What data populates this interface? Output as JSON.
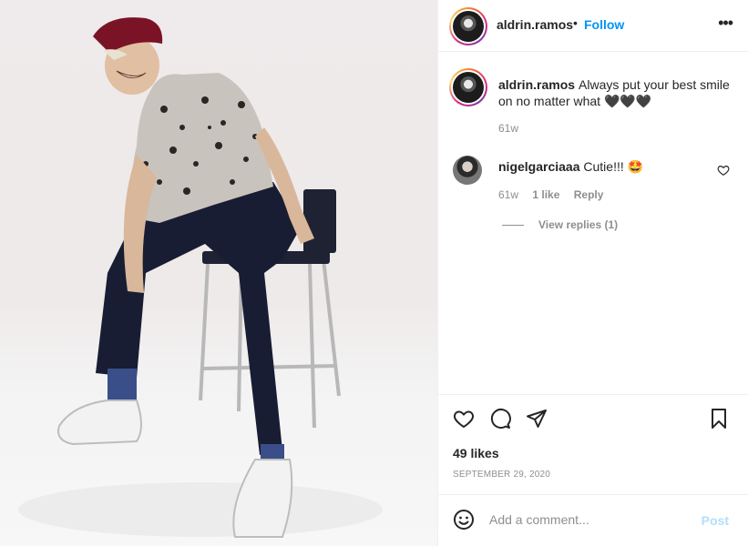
{
  "post": {
    "username": "aldrin.ramos",
    "separator": "•",
    "follow_label": "Follow",
    "more_glyph": "•••",
    "caption_user": "aldrin.ramos",
    "caption_text": "Always put your best smile on no matter what 🖤🖤🖤",
    "caption_time": "61w"
  },
  "comment": {
    "username": "nigelgarciaaa",
    "text": "Cutie!!! 🤩",
    "time": "61w",
    "likes": "1 like",
    "reply_label": "Reply",
    "view_replies": "View replies (1)"
  },
  "footer": {
    "likes": "49 likes",
    "date": "SEPTEMBER 29, 2020",
    "comment_placeholder": "Add a comment...",
    "post_label": "Post"
  },
  "icons": {
    "like": "heart-icon",
    "comment": "comment-icon",
    "share": "share-icon",
    "save": "bookmark-icon",
    "emoji": "emoji-icon",
    "more": "more-icon",
    "comment_like": "heart-icon"
  },
  "colors": {
    "follow": "#0095f6",
    "post_disabled": "#b2dffc",
    "muted": "#8e8e8e",
    "text": "#262626"
  }
}
